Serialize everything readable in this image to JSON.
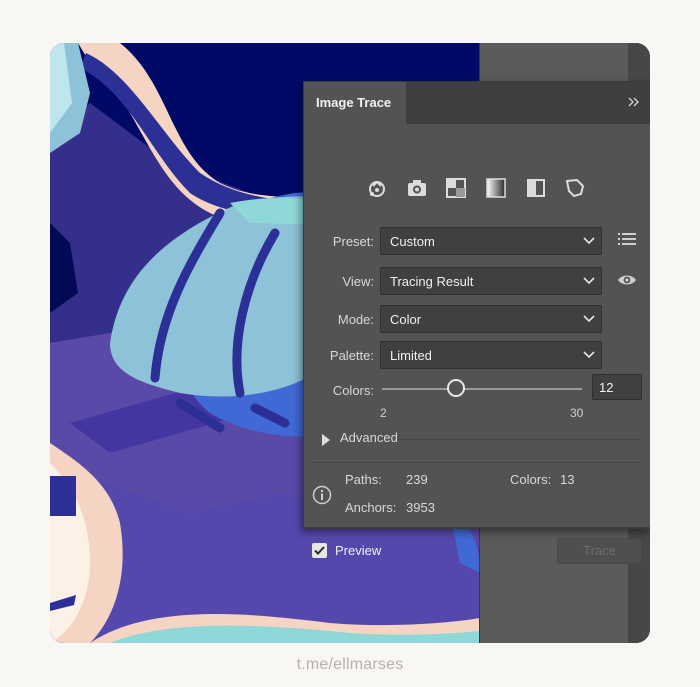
{
  "panel": {
    "title": "Image Trace",
    "collapse_icon": "double-chevron-right-icon",
    "preset_buttons": [
      {
        "name": "auto-color-icon"
      },
      {
        "name": "high-color-icon"
      },
      {
        "name": "low-color-icon"
      },
      {
        "name": "grayscale-icon"
      },
      {
        "name": "black-and-white-icon"
      },
      {
        "name": "outline-icon"
      }
    ],
    "preset": {
      "label": "Preset:",
      "value": "Custom"
    },
    "view": {
      "label": "View:",
      "value": "Tracing Result"
    },
    "mode": {
      "label": "Mode:",
      "value": "Color"
    },
    "palette": {
      "label": "Palette:",
      "value": "Limited"
    },
    "colors": {
      "label": "Colors:",
      "value": "12",
      "min": "2",
      "max": "30",
      "level": 12
    },
    "advanced": {
      "label": "Advanced"
    },
    "info": {
      "paths_label": "Paths:",
      "paths_value": "239",
      "colors_label": "Colors:",
      "colors_value": "13",
      "anchors_label": "Anchors:",
      "anchors_value": "3953"
    },
    "preview": {
      "label": "Preview",
      "checked": true
    },
    "trace_button": "Trace"
  },
  "footer": {
    "credit": "t.me/ellmarses"
  },
  "colors": {
    "panel_bg": "#535353",
    "header_bg": "#3f3f3f",
    "field_bg": "#404040",
    "artwork_navy": "#000a66",
    "artwork_violet": "#5a4aa8",
    "artwork_blue": "#4169d6",
    "artwork_light_blue": "#8ec2d8",
    "artwork_peach": "#f5d4c4"
  }
}
